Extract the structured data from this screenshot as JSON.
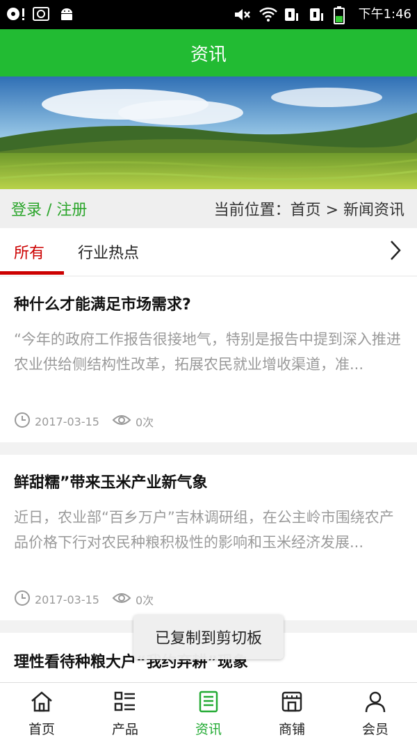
{
  "status_bar": {
    "time": "下午1:46",
    "icons": [
      "record-icon",
      "screenshot-icon",
      "android-icon",
      "mute-icon",
      "wifi-icon",
      "sim1-icon",
      "sim2-icon",
      "battery-icon"
    ]
  },
  "header": {
    "title": "资讯"
  },
  "breadcrumb": {
    "login": "登录 / 注册",
    "location": "当前位置：首页 > 新闻资讯"
  },
  "tabs": [
    {
      "label": "所有",
      "active": true
    },
    {
      "label": "行业热点",
      "active": false
    }
  ],
  "articles": [
    {
      "title": "种什么才能满足市场需求?",
      "summary": "“今年的政府工作报告很接地气，特别是报告中提到深入推进农业供给侧结构性改革，拓展农民就业增收渠道，准...",
      "date": "2017-03-15",
      "views": "0次"
    },
    {
      "title": "鲜甜糯”带来玉米产业新气象",
      "summary": "近日，农业部“百乡万户”吉林调研组，在公主岭市围绕农产品价格下行对农民种粮积极性的影响和玉米经济发展...",
      "date": "2017-03-15",
      "views": "0次"
    },
    {
      "title": "理性看待种粮大户“我约弃耕”现象"
    }
  ],
  "toast": {
    "text": "已复制到剪切板"
  },
  "bottom_nav": [
    {
      "label": "首页",
      "icon": "home-icon",
      "active": false
    },
    {
      "label": "产品",
      "icon": "product-list-icon",
      "active": false
    },
    {
      "label": "资讯",
      "icon": "news-icon",
      "active": true
    },
    {
      "label": "商铺",
      "icon": "shop-icon",
      "active": false
    },
    {
      "label": "会员",
      "icon": "user-icon",
      "active": false
    }
  ],
  "colors": {
    "brand_green": "#22bb33",
    "active_red": "#cc0000",
    "active_nav_green": "#22aa33"
  }
}
